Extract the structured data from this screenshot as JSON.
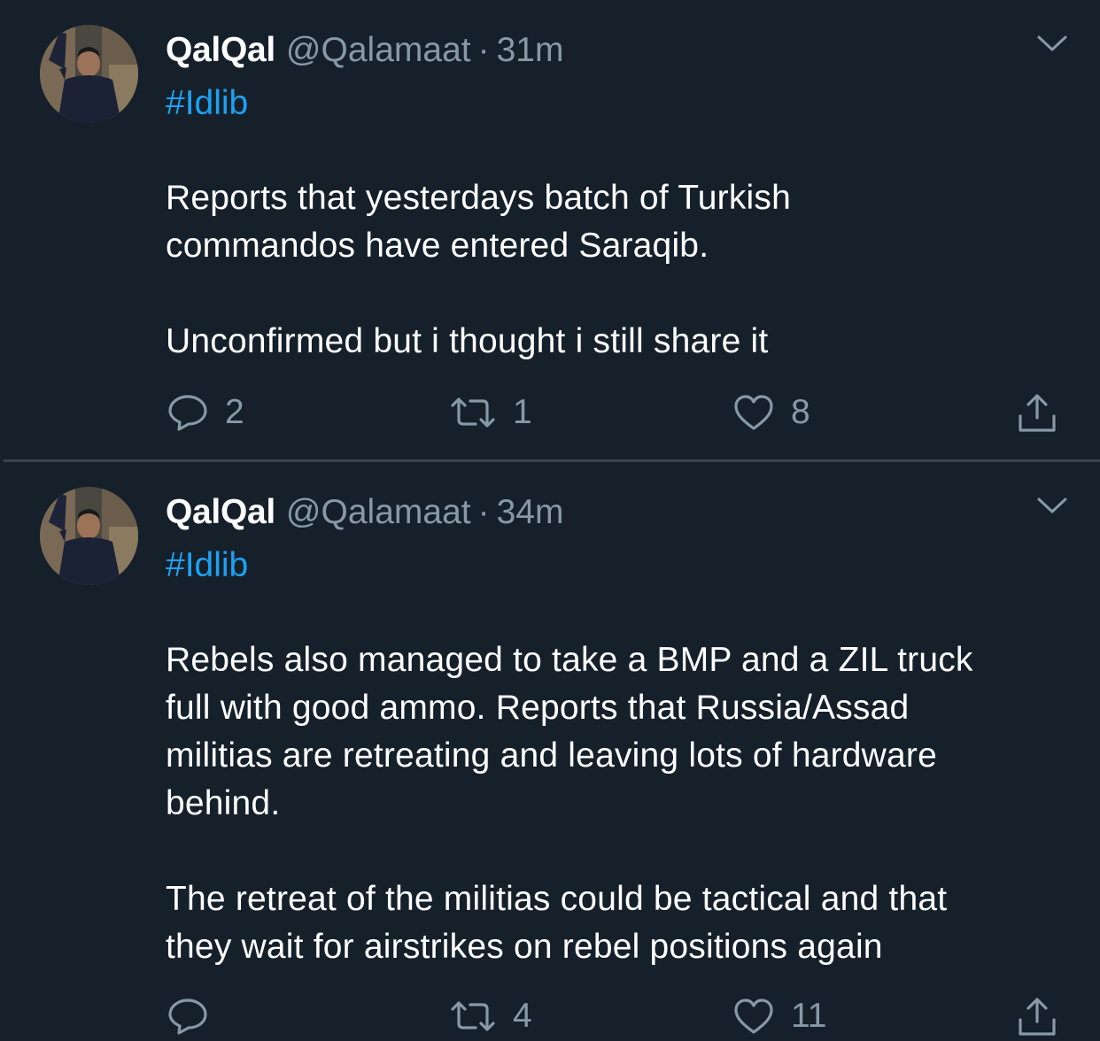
{
  "tweets": [
    {
      "display_name": "QalQal",
      "handle": "@Qalamaat",
      "separator": "·",
      "time": "31m",
      "hashtag": "#Idlib",
      "paragraphs": [
        [
          "Reports that yesterdays batch of Turkish",
          "commandos have entered Saraqib."
        ],
        [
          "Unconfirmed but i thought i still share it"
        ]
      ],
      "counts": {
        "reply": "2",
        "retweet": "1",
        "like": "8"
      }
    },
    {
      "display_name": "QalQal",
      "handle": "@Qalamaat",
      "separator": "·",
      "time": "34m",
      "hashtag": "#Idlib",
      "paragraphs": [
        [
          "Rebels also managed to take a BMP and a ZIL truck",
          "full with good ammo. Reports that Russia/Assad",
          "militias are retreating and leaving lots of hardware",
          "behind."
        ],
        [
          "The retreat of the militias could be tactical and that",
          "they wait for airstrikes on rebel positions again"
        ]
      ],
      "counts": {
        "reply": "",
        "retweet": "4",
        "like": "11"
      }
    }
  ],
  "icons": {
    "reply": "reply-icon",
    "retweet": "retweet-icon",
    "like": "heart-icon",
    "share": "share-icon",
    "menu": "chevron-down-icon"
  },
  "colors": {
    "background": "#15202b",
    "text": "#ffffff",
    "muted": "#8899a6",
    "link": "#1da1f2",
    "divider": "#38444d"
  }
}
